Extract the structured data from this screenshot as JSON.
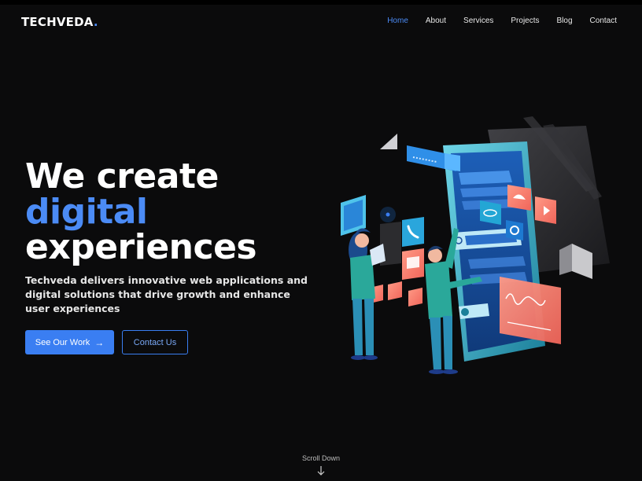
{
  "brand": {
    "name": "TECHVEDA",
    "dot": "."
  },
  "nav": {
    "items": [
      {
        "label": "Home",
        "active": true
      },
      {
        "label": "About"
      },
      {
        "label": "Services"
      },
      {
        "label": "Projects"
      },
      {
        "label": "Blog"
      },
      {
        "label": "Contact"
      }
    ]
  },
  "hero": {
    "line1": "We create",
    "line2": "digital",
    "line3": "experiences",
    "subtitle": "Techveda delivers innovative web applications and digital solutions that drive growth and enhance user experiences",
    "primary_button": "See Our Work",
    "secondary_button": "Contact Us"
  },
  "scroll": {
    "label": "Scroll Down"
  },
  "colors": {
    "accent": "#4b8bf5",
    "background": "#0b0b0c",
    "button": "#3a7ef2"
  },
  "icons": [
    "arrow-right-icon",
    "arrow-down-icon",
    "phone-icon",
    "mail-icon",
    "eye-icon",
    "gear-icon",
    "umbrella-icon",
    "play-icon",
    "search-icon"
  ]
}
